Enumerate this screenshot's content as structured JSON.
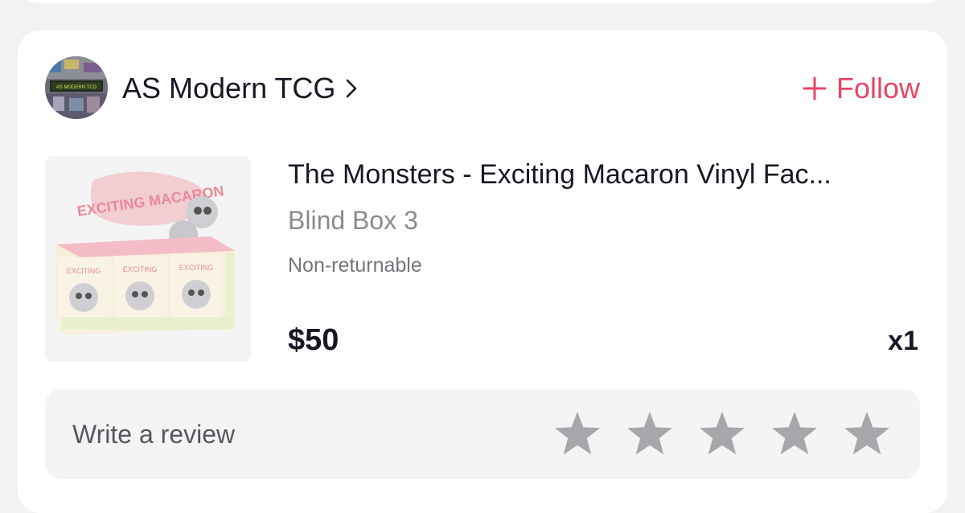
{
  "shop": {
    "name": "AS Modern TCG",
    "avatar_text": "AS MODERN TCG",
    "follow_label": "Follow"
  },
  "product": {
    "title": "The Monsters - Exciting Macaron Vinyl Fac...",
    "variant": "Blind Box 3",
    "policy": "Non-returnable",
    "price": "$50",
    "quantity": "x1",
    "image_text": "EXCITING MACARON"
  },
  "review": {
    "label": "Write a review",
    "star_count": 5
  },
  "colors": {
    "accent": "#e84666",
    "text_primary": "#161823",
    "text_secondary": "#8a8b91",
    "star": "#a6a7ab",
    "page_bg": "#f2f2f2",
    "card_bg": "#ffffff"
  },
  "icons": [
    "chevron-right-icon",
    "plus-icon",
    "star-icon"
  ]
}
